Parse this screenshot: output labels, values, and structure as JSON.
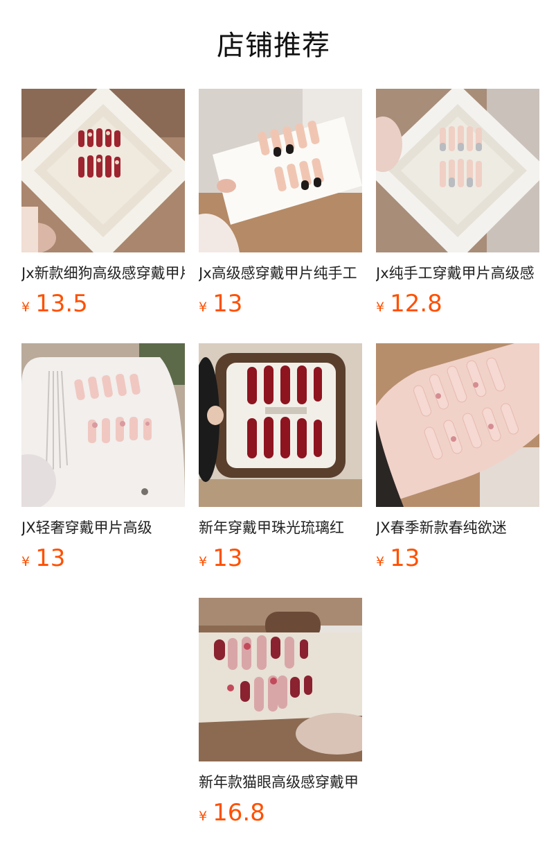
{
  "page": {
    "title": "店铺推荐"
  },
  "colors": {
    "price": "#ff5000",
    "text": "#222222",
    "background": "#ffffff"
  },
  "products": [
    {
      "name": "Jx新款细狗高级感穿戴甲片",
      "currency": "¥",
      "price": "13.5",
      "image": "red-nails-on-white-diamond-frame"
    },
    {
      "name": "Jx高级感穿戴甲片纯手工",
      "currency": "¥",
      "price": "13",
      "image": "black-french-nails-on-card"
    },
    {
      "name": "Jx纯手工穿戴甲片高级感",
      "currency": "¥",
      "price": "12.8",
      "image": "silver-nails-on-white-diamond-frame"
    },
    {
      "name": "JX轻奢穿戴甲片高级",
      "currency": "¥",
      "price": "13",
      "image": "pink-nails-with-tassel-card"
    },
    {
      "name": "新年穿戴甲珠光琉璃红",
      "currency": "¥",
      "price": "13",
      "image": "wine-red-nails-on-wood-frame"
    },
    {
      "name": "JX春季新款春纯欲迷",
      "currency": "¥",
      "price": "13",
      "image": "pink-nails-on-hand"
    },
    {
      "name": "新年款猫眼高级感穿戴甲",
      "currency": "¥",
      "price": "16.8",
      "image": "cat-eye-nails-on-fur-card"
    }
  ]
}
